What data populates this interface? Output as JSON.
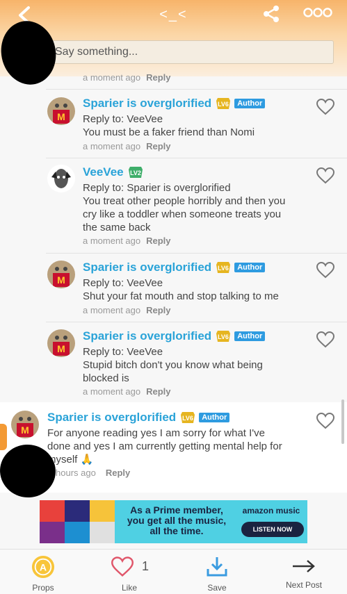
{
  "header": {
    "title": "<_<"
  },
  "composer": {
    "placeholder": "Say something..."
  },
  "comments": [
    {
      "meta_time": "a moment ago",
      "reply": "Reply"
    },
    {
      "name": "Sparier is overglorified",
      "level": "LV6",
      "badge": "Author",
      "reply_to": "Reply to: VeeVee",
      "text": "You must be a faker friend than Nomi",
      "time": "a moment ago",
      "reply": "Reply"
    },
    {
      "name": "VeeVee",
      "level": "LV2",
      "reply_to": "Reply to: Sparier is overglorified",
      "text_lines": [
        "You treat other people horribly and then you",
        "cry like a toddler when someone treats you",
        "the same back"
      ],
      "time": "a moment ago",
      "reply": "Reply"
    },
    {
      "name": "Sparier is overglorified",
      "level": "LV6",
      "badge": "Author",
      "reply_to": "Reply to: VeeVee",
      "text": "Shut your fat mouth and stop talking to me",
      "time": "a moment ago",
      "reply": "Reply"
    },
    {
      "name": "Sparier is overglorified",
      "level": "LV6",
      "badge": "Author",
      "reply_to": "Reply to: VeeVee",
      "text_lines": [
        "Stupid bitch don't you know what being",
        "blocked is"
      ],
      "time": "a moment ago",
      "reply": "Reply"
    },
    {
      "name": "Sparier is overglorified",
      "level": "LV6",
      "badge": "Author",
      "text_lines": [
        "For anyone reading yes I am sorry for what I've",
        "done and yes I am currently getting mental help for",
        "myself 🙏"
      ],
      "time": "hours ago",
      "reply": "Reply"
    }
  ],
  "ad": {
    "line1": "As a Prime member,",
    "line2": "you get all the music,",
    "line3": "all the time.",
    "brand": "amazon music",
    "button": "LISTEN NOW",
    "colors": {
      "background": "#4fd0e3",
      "button": "#1a2340"
    }
  },
  "bottom_bar": {
    "props": "Props",
    "like": "Like",
    "like_count": "1",
    "save": "Save",
    "next": "Next Post"
  },
  "colors": {
    "accent": "#2aa3d8",
    "author_badge": "#2e9be0",
    "header_orange": "#f7b46a"
  }
}
